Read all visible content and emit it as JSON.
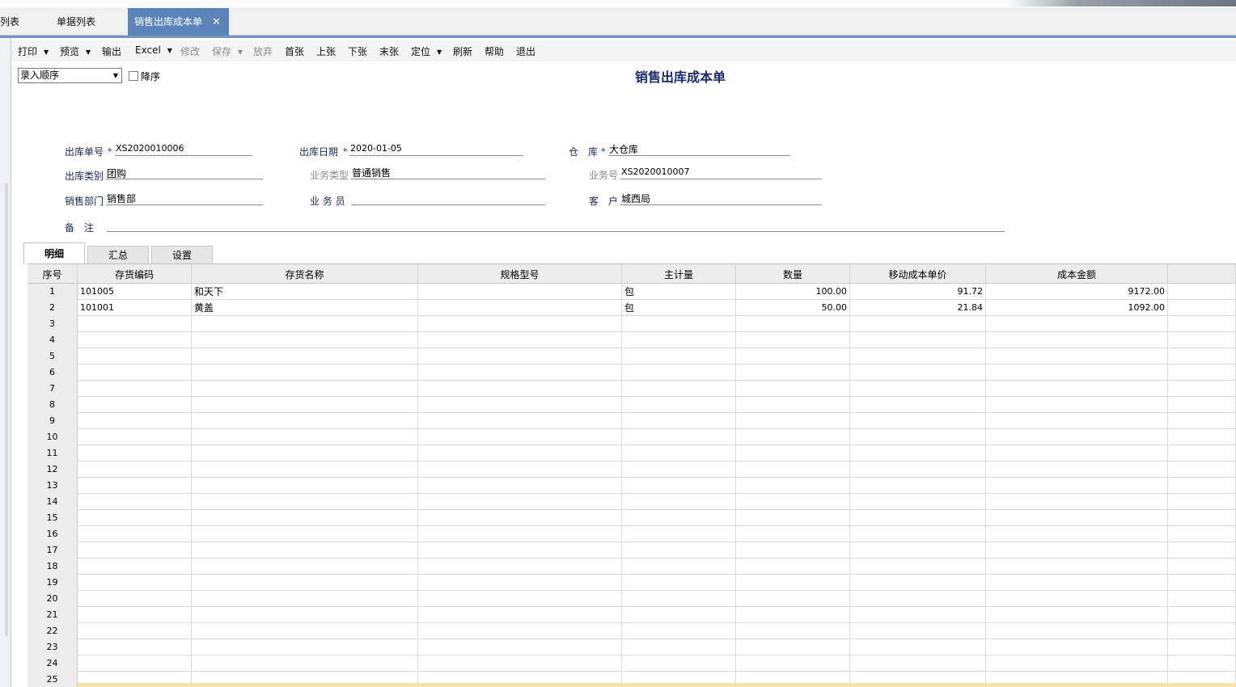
{
  "tabs": [
    {
      "label": "列表"
    },
    {
      "label": "单据列表"
    },
    {
      "label": "销售出库成本单",
      "close": "✕"
    }
  ],
  "toolbar": {
    "print": "打印",
    "preview": "预览",
    "output": "输出",
    "excel": "Excel",
    "modify": "修改",
    "save": "保存",
    "discard": "放弃",
    "first": "首张",
    "prev": "上张",
    "next": "下张",
    "last": "末张",
    "locate": "定位",
    "refresh": "刷新",
    "help": "帮助",
    "exit": "退出",
    "dropdown_glyph": "▼"
  },
  "sort": {
    "selected": "录入顺序",
    "desc_label": "降序",
    "desc_checked": false
  },
  "title": "销售出库成本单",
  "header": {
    "required_mark": "*",
    "out_no_label": "出库单号",
    "out_no": "XS2020010006",
    "out_date_label": "出库日期",
    "out_date": "2020-01-05",
    "warehouse_label": "仓　库",
    "warehouse": "大仓库",
    "out_type_label": "出库类别",
    "out_type": "团购",
    "biz_type_label": "业务类型",
    "biz_type": "普通销售",
    "biz_no_label": "业务号",
    "biz_no": "XS2020010007",
    "dept_label": "销售部门",
    "dept": "销售部",
    "salesman_label": "业 务 员",
    "salesman": "",
    "customer_label": "客　户",
    "customer": "城西局",
    "remark_label": "备　注",
    "remark": ""
  },
  "subtabs": [
    "明细",
    "汇总",
    "设置"
  ],
  "grid": {
    "columns": [
      "序号",
      "存货编码",
      "存货名称",
      "规格型号",
      "主计量",
      "数量",
      "移动成本单价",
      "成本金额"
    ],
    "rows": [
      {
        "no": "1",
        "code": "101005",
        "name": "和天下",
        "spec": "",
        "unit": "包",
        "qty": "100.00",
        "price": "91.72",
        "amount": "9172.00"
      },
      {
        "no": "2",
        "code": "101001",
        "name": "黄盖",
        "spec": "",
        "unit": "包",
        "qty": "50.00",
        "price": "21.84",
        "amount": "1092.00"
      },
      {
        "no": "3"
      },
      {
        "no": "4"
      },
      {
        "no": "5"
      },
      {
        "no": "6"
      },
      {
        "no": "7"
      },
      {
        "no": "8"
      },
      {
        "no": "9"
      },
      {
        "no": "10"
      },
      {
        "no": "11"
      },
      {
        "no": "12"
      },
      {
        "no": "13"
      },
      {
        "no": "14"
      },
      {
        "no": "15"
      },
      {
        "no": "16"
      },
      {
        "no": "17"
      },
      {
        "no": "18"
      },
      {
        "no": "19"
      },
      {
        "no": "20"
      },
      {
        "no": "21"
      },
      {
        "no": "22"
      },
      {
        "no": "23"
      },
      {
        "no": "24"
      },
      {
        "no": "25"
      }
    ]
  }
}
